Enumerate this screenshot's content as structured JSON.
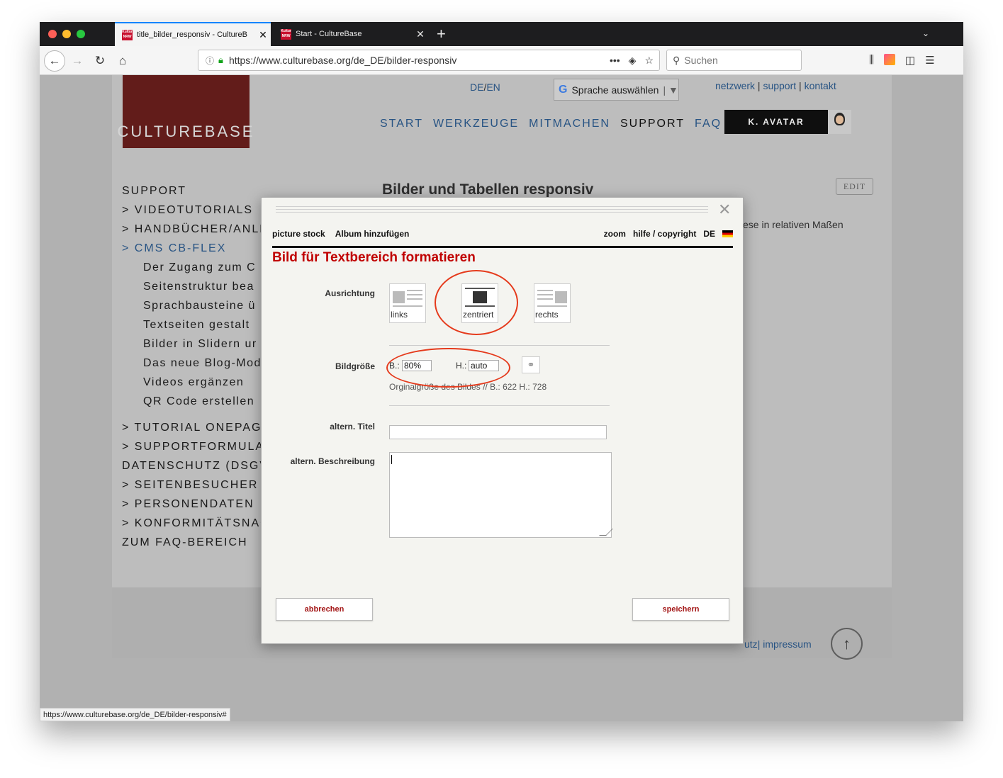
{
  "browser": {
    "tabs": [
      {
        "title": "title_bilder_responsiv - CultureB",
        "favicon": "Kultur NRW"
      },
      {
        "title": "Start - CultureBase",
        "favicon": "Kultur NRW"
      }
    ],
    "url": "https://www.culturebase.org/de_DE/bilder-responsiv",
    "search_placeholder": "Suchen",
    "status_url": "https://www.culturebase.org/de_DE/bilder-responsiv#"
  },
  "site": {
    "logo": "CULTUREBASE",
    "lang_de": "DE",
    "lang_sep": "/",
    "lang_en": "EN",
    "translate_label": "Sprache auswählen",
    "toplinks": {
      "netzwerk": "netzwerk",
      "support": "support",
      "kontakt": "kontakt",
      "sep": "|"
    },
    "mainnav": [
      "START",
      "WERKZEUGE",
      "MITMACHEN",
      "SUPPORT",
      "FAQ"
    ],
    "avatar_label": "K. AVATAR",
    "edit_label": "EDIT",
    "content_title": "Bilder und Tabellen responsiv",
    "content_text": "ese in relativen Maßen",
    "footer_partial": "utz",
    "footer_impressum": "impressum",
    "footer_sep": "|"
  },
  "sidebar": {
    "heading": "SUPPORT",
    "items": [
      "> VIDEOTUTORIALS",
      "> HANDBÜCHER/ANLE",
      "> CMS CB-FLEX"
    ],
    "sub_items": [
      "Der Zugang zum C",
      "Seitenstruktur bea",
      "Sprachbausteine ü",
      "Textseiten gestalt",
      "Bilder in Slidern ur",
      "Das neue Blog-Mod",
      "Videos ergänzen",
      "QR Code erstellen"
    ],
    "items_after": [
      "> TUTORIAL ONEPAGE",
      "> SUPPORTFORMULAR",
      "DATENSCHUTZ (DSGV",
      "> SEITENBESUCHER",
      "> PERSONENDATEN",
      "> KONFORMITÄTSNAC",
      "ZUM FAQ-BEREICH"
    ]
  },
  "modal": {
    "tab_picture_stock": "picture stock",
    "tab_album": "Album hinzufügen",
    "zoom": "zoom",
    "help": "hilfe / copyright",
    "lang": "DE",
    "heading": "Bild für Textbereich formatieren",
    "label_alignment": "Ausrichtung",
    "align_options": [
      "links",
      "zentriert",
      "rechts"
    ],
    "selected_alignment": "zentriert",
    "label_size": "Bildgröße",
    "width_label": "B.:",
    "width_value": "80%",
    "height_label": "H.:",
    "height_value": "auto",
    "original_size": "Orginalgröße des Bildes // B.: 622 H.: 728",
    "label_alt_title": "altern. Titel",
    "alt_title_value": "",
    "label_alt_desc": "altern. Beschreibung",
    "alt_desc_value": "",
    "cancel": "abbrechen",
    "save": "speichern"
  },
  "colors": {
    "brand": "#6b1f1d",
    "link": "#2b5b8f",
    "heading_red": "#c00000",
    "annotation": "#e53a1c"
  }
}
